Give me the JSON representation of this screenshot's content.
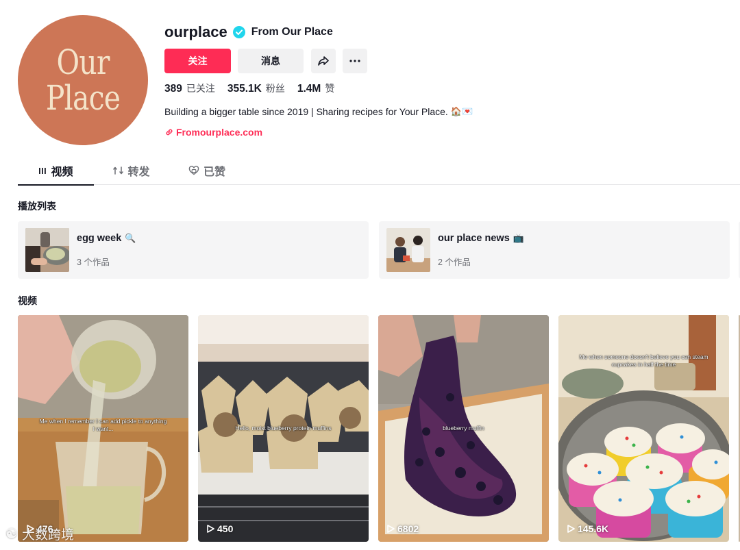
{
  "profile": {
    "avatar_text_line1": "Our",
    "avatar_text_line2": "Place",
    "username": "ourplace",
    "nickname": "From Our Place",
    "follow_label": "关注",
    "message_label": "消息",
    "stats": {
      "following_count": "389",
      "following_label": "已关注",
      "followers_count": "355.1K",
      "followers_label": "粉丝",
      "likes_count": "1.4M",
      "likes_label": "赞"
    },
    "bio": "Building a bigger table since 2019 | Sharing recipes for Your Place.",
    "bio_emojis": "🏠💌",
    "link": "Fromourplace.com",
    "accent_color": "#fe2c55",
    "avatar_color": "#cd7656"
  },
  "tabs": [
    {
      "label": "视频",
      "icon": "grid-icon",
      "active": true
    },
    {
      "label": "转发",
      "icon": "repost-icon",
      "active": false
    },
    {
      "label": "已赞",
      "icon": "liked-heart-icon",
      "active": false
    }
  ],
  "playlists": {
    "title": "播放列表",
    "items": [
      {
        "title": "egg week",
        "emoji": "🔍",
        "count": "3 个作品"
      },
      {
        "title": "our place news",
        "emoji": "📺",
        "count": "2 个作品"
      }
    ]
  },
  "videos": {
    "title": "视频",
    "items": [
      {
        "caption": "Me when I remember I can add pickle to anything I want...",
        "views": "476"
      },
      {
        "caption": "Hello, moist blueberry protein muffins",
        "views": "450"
      },
      {
        "caption": "blueberry muffin",
        "views": "6802"
      },
      {
        "caption": "Me when someone doesn't believe you can steam cupcakes in half the time",
        "views": "145.6K"
      }
    ]
  },
  "watermark": {
    "logo": "☯",
    "text": "大数跨境"
  }
}
